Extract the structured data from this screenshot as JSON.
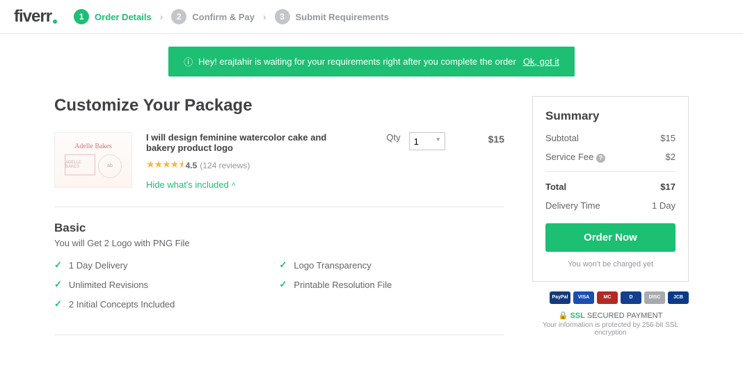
{
  "logo": "fiverr",
  "steps": [
    {
      "num": "1",
      "label": "Order Details",
      "active": true
    },
    {
      "num": "2",
      "label": "Confirm & Pay",
      "active": false
    },
    {
      "num": "3",
      "label": "Submit Requirements",
      "active": false
    }
  ],
  "notice": {
    "text": "Hey! erajtahir is waiting for your requirements right after you complete the order",
    "link": "Ok, got it"
  },
  "page_title": "Customize Your Package",
  "gig": {
    "title": "I will design feminine watercolor cake and bakery product logo",
    "rating": "4.5",
    "reviews": "(124 reviews)",
    "hide_link": "Hide what's included",
    "qty_label": "Qty",
    "qty_value": "1",
    "price": "$15"
  },
  "package": {
    "name": "Basic",
    "desc": "You will Get 2 Logo with PNG File",
    "features_left": [
      "1 Day Delivery",
      "Unlimited Revisions",
      "2 Initial Concepts Included"
    ],
    "features_right": [
      "Logo Transparency",
      "Printable Resolution File"
    ]
  },
  "summary": {
    "title": "Summary",
    "subtotal_label": "Subtotal",
    "subtotal": "$15",
    "fee_label": "Service Fee",
    "fee": "$2",
    "total_label": "Total",
    "total": "$17",
    "delivery_label": "Delivery Time",
    "delivery": "1 Day",
    "button": "Order Now",
    "no_charge": "You won't be charged yet"
  },
  "payment_badges": [
    {
      "label": "PayPal",
      "bg": "#153a7c"
    },
    {
      "label": "VISA",
      "bg": "#1a4fb1"
    },
    {
      "label": "MC",
      "bg": "#b22a23"
    },
    {
      "label": "D",
      "bg": "#123f8f"
    },
    {
      "label": "DISC",
      "bg": "#a9aaad"
    },
    {
      "label": "JCB",
      "bg": "#0a3b8a"
    }
  ],
  "ssl": {
    "green": "SSL",
    "rest": "SECURED PAYMENT",
    "sub": "Your information is protected by 256-bit SSL encryption"
  }
}
